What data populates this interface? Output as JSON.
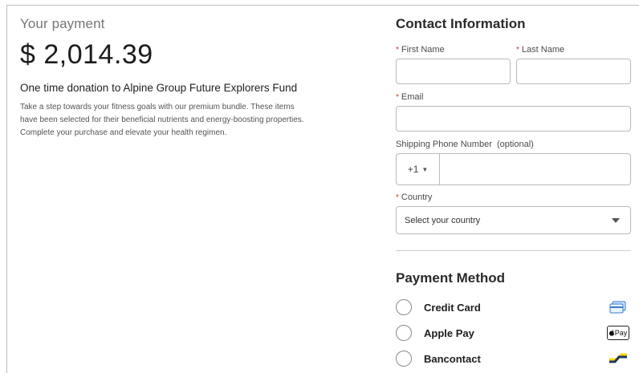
{
  "payment": {
    "label": "Your payment",
    "amount": "$ 2,014.39",
    "donation": "One time donation to Alpine Group Future Explorers Fund",
    "description": "Take a step towards your fitness goals with our premium bundle. These items have been selected for their beneficial nutrients and energy-boosting properties. Complete your purchase and elevate your health regimen."
  },
  "contact": {
    "title": "Contact Information",
    "required_marker": "*",
    "first_name_label": "First Name",
    "last_name_label": "Last Name",
    "email_label": "Email",
    "phone_label": "Shipping Phone Number  (optional)",
    "country_code": "+1",
    "country_label": "Country",
    "country_placeholder": "Select your country"
  },
  "payment_method": {
    "title": "Payment Method",
    "options": [
      {
        "label": "Credit Card",
        "icon": "credit-card-icon"
      },
      {
        "label": "Apple Pay",
        "icon": "apple-pay-icon",
        "icon_text": "Pay"
      },
      {
        "label": "Bancontact",
        "icon": "bancontact-icon"
      }
    ]
  },
  "colors": {
    "required": "#c0392b",
    "border": "#b9b9b9",
    "bancontact_blue": "#1e3764",
    "bancontact_yellow": "#ffd800"
  }
}
